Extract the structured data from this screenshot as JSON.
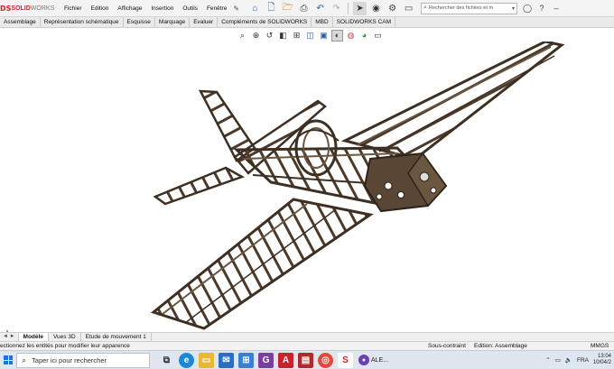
{
  "app": {
    "logo_prefix": "DS",
    "logo_brand_bold": "SOLID",
    "logo_brand_light": "WORKS"
  },
  "menu": [
    "Fichier",
    "Edition",
    "Affichage",
    "Insertion",
    "Outils",
    "Fenêtre"
  ],
  "search": {
    "placeholder": "Rechercher des fichiers et m"
  },
  "tabs": [
    "Assemblage",
    "Représentation schématique",
    "Esquisse",
    "Marquage",
    "Evaluer",
    "Compléments de SOLIDWORKS",
    "MBD",
    "SOLIDWORKS CAM"
  ],
  "model_tabs": [
    "Modèle",
    "Vues 3D",
    "Etude de mouvement 1"
  ],
  "model_tab_arrows": "◄ ►",
  "status": {
    "hint": "ectionnez les entités pour modifier leur apparence",
    "constraint": "Sous-contraint",
    "mode": "Edition: Assemblage",
    "units": "MMGS"
  },
  "taskbar": {
    "search_placeholder": "Taper ici pour rechercher",
    "user_label": "ALE...",
    "language": "FRA",
    "time": "13:04",
    "date": "10/04/2"
  },
  "colors": {
    "brand_red": "#d62027",
    "wood": "#4b3a2a",
    "wood_light": "#6b5640",
    "win_blue": "#1a73d9"
  }
}
